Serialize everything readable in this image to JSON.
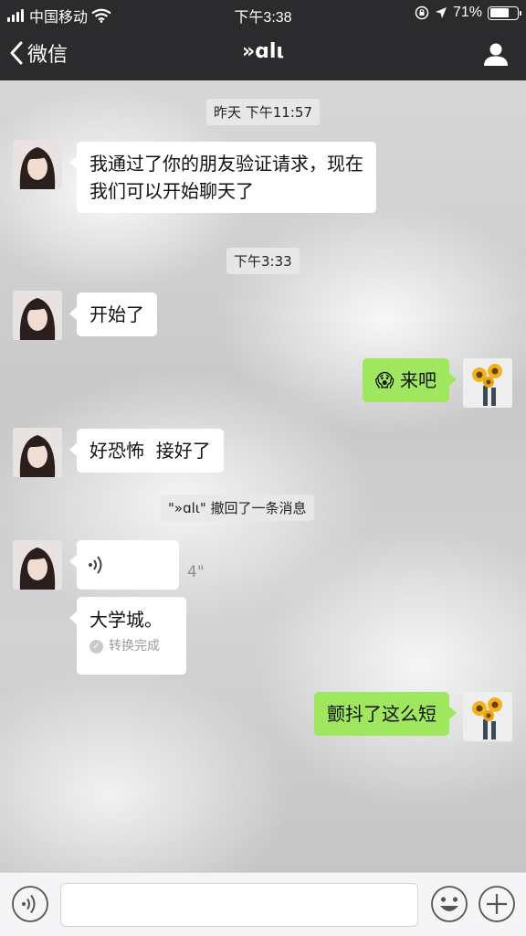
{
  "status_bar": {
    "carrier": "中国移动",
    "time": "下午3:38",
    "battery_percent": "71%",
    "battery_level": 0.71,
    "icons": [
      "signal-icon",
      "wifi-icon",
      "rotation-lock-icon",
      "location-icon",
      "battery-icon"
    ]
  },
  "nav": {
    "back_label": "微信",
    "title": "»ɑlι",
    "right_icon": "person-icon"
  },
  "messages": {
    "time_1": "昨天 下午11:57",
    "m1": "我通过了你的朋友验证请求，现在",
    "m1_line2": "我们可以开始聊天了",
    "time_2": "下午3:33",
    "m2": "开始了",
    "m3_emoji": "😱",
    "m3_text": "来吧",
    "m4": "好恐怖  接好了",
    "recall_notice": "\"»ɑlι\" 撤回了一条消息",
    "voice_duration": "4\"",
    "voice_transcript": "大学城。",
    "convert_status": "转换完成",
    "m6": "颤抖了这么短"
  },
  "input_bar": {
    "icons": [
      "voice-icon",
      "emoji-icon",
      "plus-icon"
    ]
  },
  "colors": {
    "header_bg": "#2b2b2d",
    "outgoing_bubble": "#9fe75f",
    "incoming_bubble": "#ffffff"
  }
}
